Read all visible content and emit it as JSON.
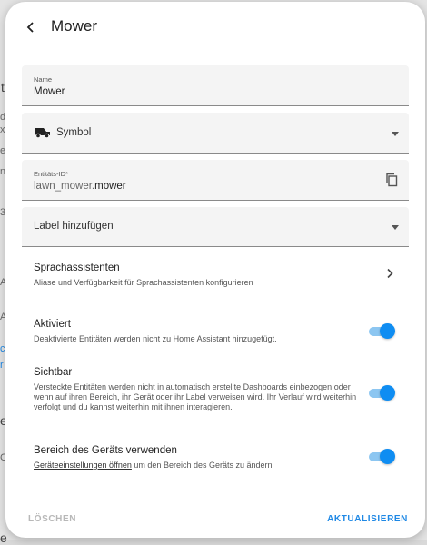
{
  "dialog": {
    "title": "Mower",
    "name_field": {
      "label": "Name",
      "value": "Mower"
    },
    "icon_field": {
      "placeholder": "Symbol",
      "icon": "robot-mower-icon"
    },
    "entity_field": {
      "label": "Entitäts-ID*",
      "value_prefix": "lawn_mower.",
      "value_suffix": "mower",
      "copy_icon": "copy-icon"
    },
    "labels_field": {
      "placeholder": "Label hinzufügen"
    },
    "voice": {
      "title": "Sprachassistenten",
      "desc": "Aliase und Verfügbarkeit für Sprachassistenten konfigurieren"
    },
    "enabled": {
      "title": "Aktiviert",
      "desc": "Deaktivierte Entitäten werden nicht zu Home Assistant hinzugefügt.",
      "on": true
    },
    "visible": {
      "title": "Sichtbar",
      "desc": "Versteckte Entitäten werden nicht in automatisch erstellte Dashboards einbezogen oder wenn auf ihren Bereich, ihr Gerät oder ihr Label verweisen wird. Ihr Verlauf wird weiterhin verfolgt und du kannst weiterhin mit ihnen interagieren.",
      "on": true
    },
    "device_area": {
      "title": "Bereich des Geräts verwenden",
      "link": "Geräteeinstellungen öffnen",
      "desc_suffix": " um den Bereich des Geräts zu ändern",
      "on": true
    },
    "buttons": {
      "delete": "LÖSCHEN",
      "update": "AKTUALISIEREN"
    }
  },
  "colors": {
    "accent": "#0f8df2",
    "accent_text": "#1e88e5",
    "disabled": "#b8b8b8"
  }
}
